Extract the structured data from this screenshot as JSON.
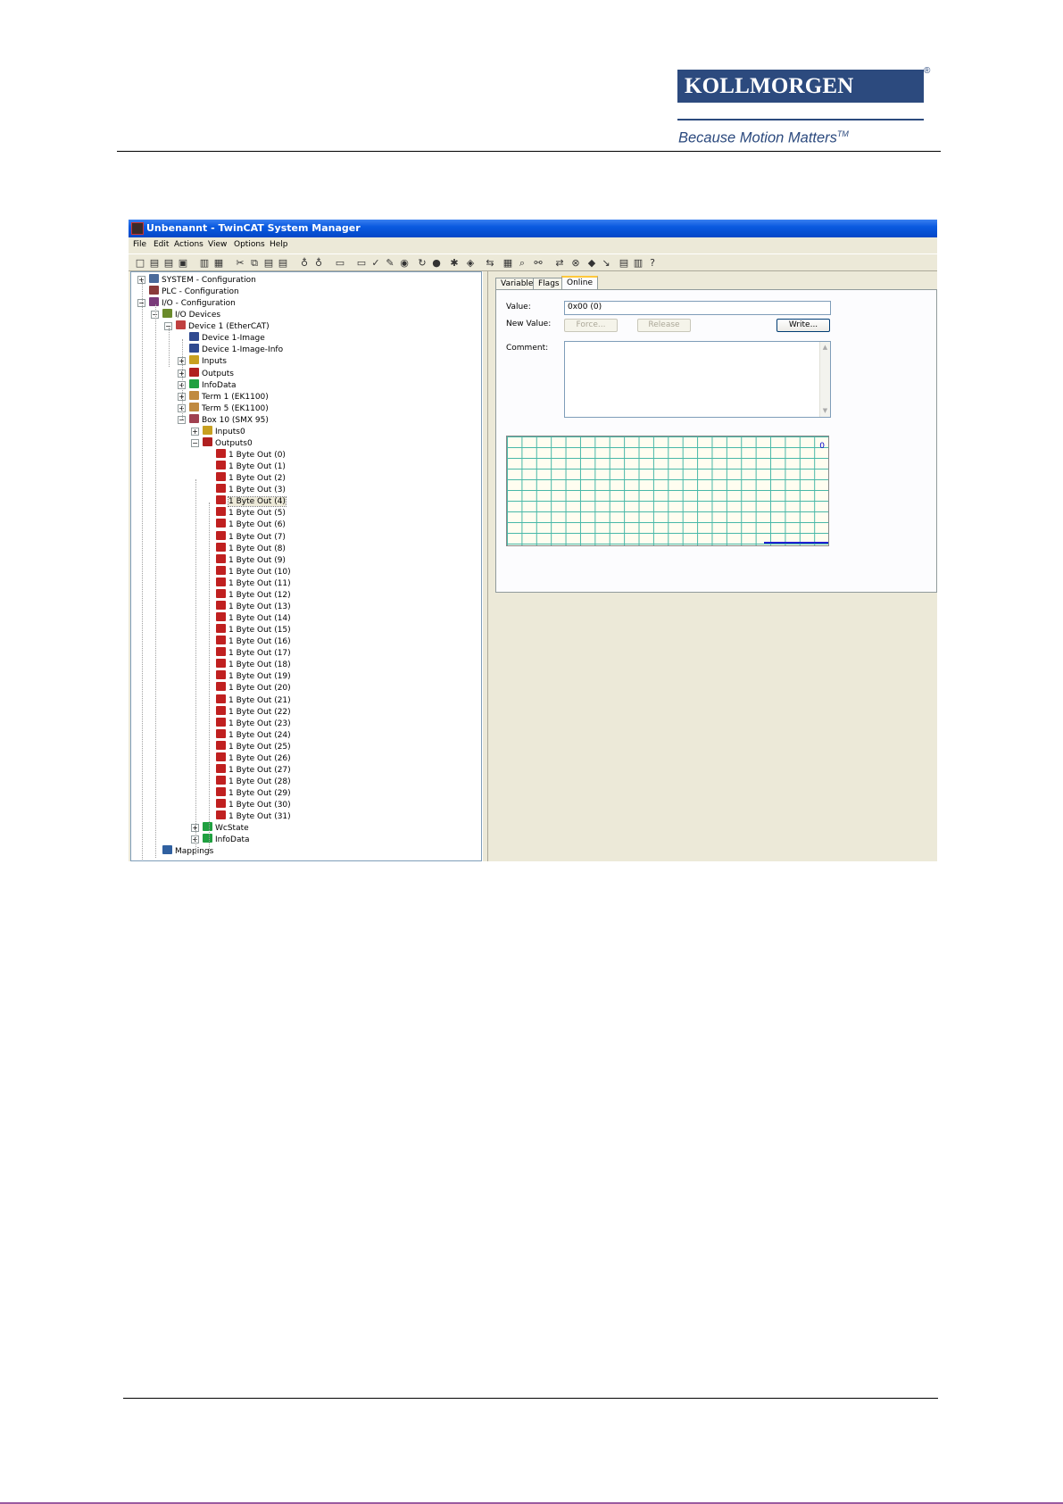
{
  "header": {
    "logo_text": "KOLLMORGEN",
    "registered_mark": "®",
    "tagline": "Because Motion Matters",
    "tagline_tm": "TM"
  },
  "window": {
    "title": "Unbenannt - TwinCAT System Manager",
    "menu": [
      "File",
      "Edit",
      "Actions",
      "View",
      "Options",
      "Help"
    ],
    "toolbar_icons": [
      "new-icon",
      "open-icon",
      "open-folder-icon",
      "save-icon",
      "print-icon",
      "print-preview-icon",
      "cut-icon",
      "copy-icon",
      "paste-icon",
      "paste-special-icon",
      "find-icon",
      "find-next-icon",
      "target-system-icon",
      "generate-mappings-icon",
      "check-config-icon",
      "activate-config-icon",
      "restart-icon",
      "reload-icon",
      "scan-devices-icon",
      "free-run-icon",
      "online-icon",
      "toggle-icon",
      "show-online-icon",
      "zoom-icon",
      "link-icon",
      "online-sync-icon",
      "plc-icon",
      "logger-icon",
      "show-sub-icon",
      "help-book-icon",
      "about-icon",
      "help-icon"
    ]
  },
  "tree": {
    "nodes": [
      {
        "label": "SYSTEM - Configuration",
        "icon": "system-config-icon"
      },
      {
        "label": "PLC - Configuration",
        "icon": "plc-config-icon"
      },
      {
        "label": "I/O - Configuration",
        "icon": "io-config-icon"
      },
      {
        "label": "I/O Devices",
        "icon": "io-devices-icon"
      },
      {
        "label": "Device 1 (EtherCAT)",
        "icon": "ethercat-device-icon"
      },
      {
        "label": "Device 1-Image",
        "icon": "image-icon"
      },
      {
        "label": "Device 1-Image-Info",
        "icon": "image-info-icon"
      },
      {
        "label": "Inputs",
        "icon": "inputs-icon"
      },
      {
        "label": "Outputs",
        "icon": "outputs-icon"
      },
      {
        "label": "InfoData",
        "icon": "infodata-icon"
      },
      {
        "label": "Term 1 (EK1100)",
        "icon": "terminal-icon"
      },
      {
        "label": "Term 5 (EK1100)",
        "icon": "terminal-icon"
      },
      {
        "label": "Box 10 (SMX 95)",
        "icon": "box-icon"
      },
      {
        "label": "Inputs0",
        "icon": "inputs-icon"
      },
      {
        "label": "Outputs0",
        "icon": "outputs-icon"
      }
    ],
    "byte_outs": [
      "1 Byte Out (0)",
      "1 Byte Out (1)",
      "1 Byte Out (2)",
      "1 Byte Out (3)",
      "1 Byte Out (4)",
      "1 Byte Out (5)",
      "1 Byte Out (6)",
      "1 Byte Out (7)",
      "1 Byte Out (8)",
      "1 Byte Out (9)",
      "1 Byte Out (10)",
      "1 Byte Out (11)",
      "1 Byte Out (12)",
      "1 Byte Out (13)",
      "1 Byte Out (14)",
      "1 Byte Out (15)",
      "1 Byte Out (16)",
      "1 Byte Out (17)",
      "1 Byte Out (18)",
      "1 Byte Out (19)",
      "1 Byte Out (20)",
      "1 Byte Out (21)",
      "1 Byte Out (22)",
      "1 Byte Out (23)",
      "1 Byte Out (24)",
      "1 Byte Out (25)",
      "1 Byte Out (26)",
      "1 Byte Out (27)",
      "1 Byte Out (28)",
      "1 Byte Out (29)",
      "1 Byte Out (30)",
      "1 Byte Out (31)"
    ],
    "selected_index": 4,
    "tail": [
      {
        "label": "WcState",
        "icon": "wcstate-icon"
      },
      {
        "label": "InfoData",
        "icon": "infodata-icon"
      },
      {
        "label": "Mappings",
        "icon": "mappings-icon"
      }
    ]
  },
  "panel": {
    "tabs": [
      "Variable",
      "Flags",
      "Online"
    ],
    "active_tab": "Online",
    "value_label": "Value:",
    "value": "0x00 (0)",
    "new_value_label": "New Value:",
    "force_button": "Force...",
    "release_button": "Release",
    "write_button": "Write...",
    "comment_label": "Comment:",
    "comment": "",
    "graph_value": "0"
  },
  "colors": {
    "brand": "#2c4a7e",
    "titlebar": "#0a5ae0",
    "grid": "#48b8a8",
    "trace": "#2020d0"
  }
}
